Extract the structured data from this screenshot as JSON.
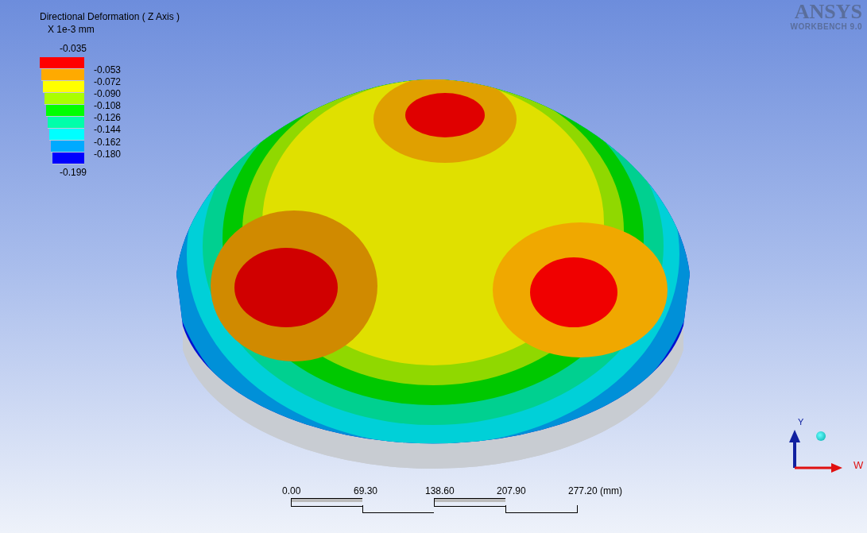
{
  "legend": {
    "title": "Directional Deformation ( Z Axis )",
    "unit": "X 1e-3 mm",
    "max_label": "-0.035",
    "min_label": "-0.199",
    "bands": [
      {
        "color": "#ff0000"
      },
      {
        "color": "#ffaa00"
      },
      {
        "color": "#ffff00"
      },
      {
        "color": "#aaff00"
      },
      {
        "color": "#00ff00"
      },
      {
        "color": "#00ffaa"
      },
      {
        "color": "#00ffff"
      },
      {
        "color": "#00aaff"
      },
      {
        "color": "#0000ff"
      }
    ],
    "levels": [
      "-0.053",
      "-0.072",
      "-0.090",
      "-0.108",
      "-0.126",
      "-0.144",
      "-0.162",
      "-0.180"
    ]
  },
  "logo": {
    "brand": "ANSYS",
    "product": "WORKBENCH 9.0"
  },
  "triad": {
    "up_label": "Y",
    "right_label": "W"
  },
  "scale_bar": {
    "ticks": [
      "0.00",
      "69.30",
      "138.60",
      "207.90",
      "277.20 (mm)"
    ]
  }
}
